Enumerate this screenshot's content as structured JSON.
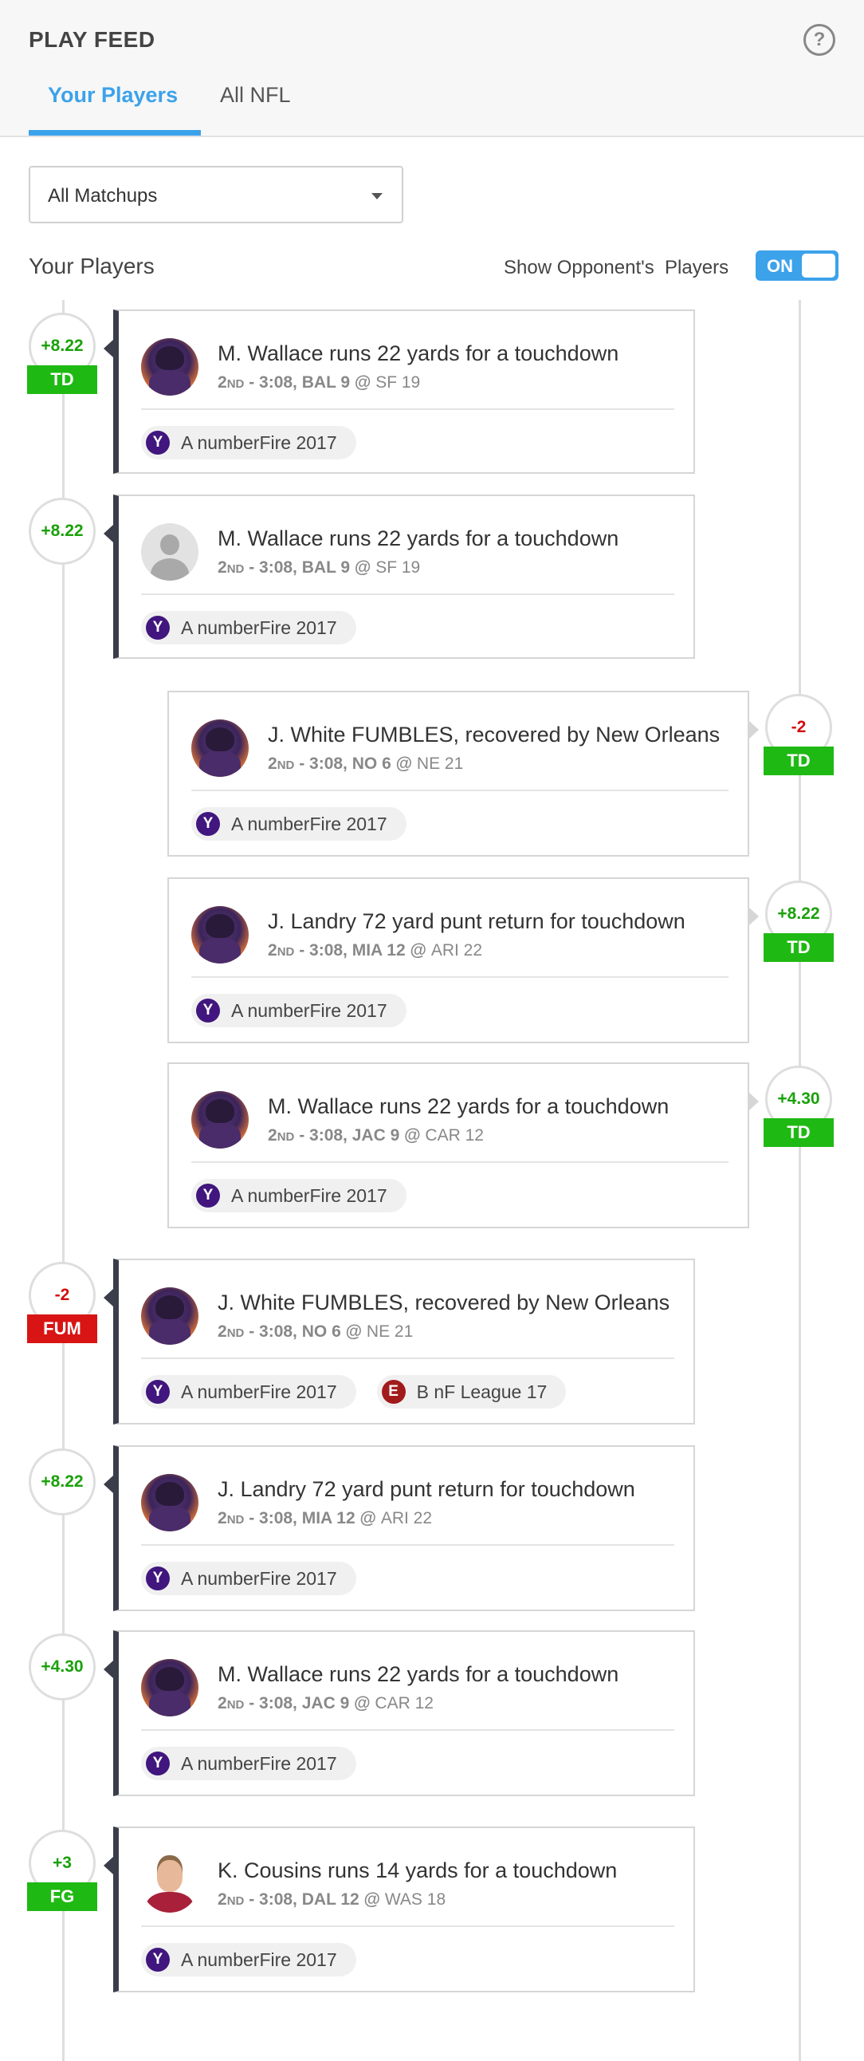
{
  "header": {
    "title": "PLAY FEED",
    "help_icon": "question-circle-icon",
    "tabs": [
      {
        "label": "Your Players",
        "active": true
      },
      {
        "label": "All NFL",
        "active": false
      }
    ]
  },
  "filter": {
    "matchup_select": "All Matchups"
  },
  "section_label": "Your Players",
  "opponent_toggle": {
    "label": "Show Opponent's  Players",
    "state": "ON"
  },
  "colors": {
    "accent": "#3ca2ea",
    "positive": "#1aa10a",
    "negative": "#d40c0c",
    "td_badge": "#1fb913",
    "fum_badge": "#d81414",
    "card_accent": "#3a3d4a"
  },
  "plays": [
    {
      "headline": "M. Wallace runs 22 yards for a touchdown",
      "quarter": "2",
      "quarter_suffix": "ND",
      "clock": " - 3:08, ",
      "team_a": "BAL 9",
      "at": " @ ",
      "team_b": "SF 19",
      "points": "+8.22",
      "tag": "TD",
      "avatar": "ravens-player",
      "leagues": [
        {
          "name": "A numberFire 2017",
          "icon": "Y"
        }
      ]
    },
    {
      "headline": "M. Wallace runs 22 yards for a touchdown",
      "quarter": "2",
      "quarter_suffix": "ND",
      "clock": " - 3:08, ",
      "team_a": "BAL 9",
      "at": " @ ",
      "team_b": "SF 19",
      "points": "+8.22",
      "tag": "",
      "avatar": "generic-user",
      "leagues": [
        {
          "name": "A numberFire 2017",
          "icon": "Y"
        }
      ]
    },
    {
      "headline": "J. White FUMBLES, recovered by New Orleans",
      "quarter": "2",
      "quarter_suffix": "ND",
      "clock": " - 3:08, ",
      "team_a": "NO 6",
      "at": " @ ",
      "team_b": "NE 21",
      "points": "-2",
      "tag": "TD",
      "avatar": "ravens-player",
      "leagues": [
        {
          "name": "A numberFire 2017",
          "icon": "Y"
        }
      ]
    },
    {
      "headline": "J. Landry 72 yard punt return for touchdown",
      "quarter": "2",
      "quarter_suffix": "ND",
      "clock": " - 3:08, ",
      "team_a": "MIA 12",
      "at": " @ ",
      "team_b": "ARI 22",
      "points": "+8.22",
      "tag": "TD",
      "avatar": "ravens-player",
      "leagues": [
        {
          "name": "A numberFire 2017",
          "icon": "Y"
        }
      ]
    },
    {
      "headline": "M. Wallace runs 22 yards for a touchdown",
      "quarter": "2",
      "quarter_suffix": "ND",
      "clock": " - 3:08, ",
      "team_a": "JAC 9",
      "at": " @ ",
      "team_b": "CAR 12",
      "points": "+4.30",
      "tag": "TD",
      "avatar": "ravens-player",
      "leagues": [
        {
          "name": "A numberFire 2017",
          "icon": "Y"
        }
      ]
    },
    {
      "headline": "J. White FUMBLES, recovered by New Orleans",
      "quarter": "2",
      "quarter_suffix": "ND",
      "clock": " - 3:08, ",
      "team_a": "NO 6",
      "at": " @ ",
      "team_b": "NE 21",
      "points": "-2",
      "tag": "FUM",
      "avatar": "ravens-player",
      "leagues": [
        {
          "name": "A numberFire 2017",
          "icon": "Y"
        },
        {
          "name": "B nF League 17",
          "icon": "E"
        }
      ]
    },
    {
      "headline": "J. Landry 72 yard punt return for touchdown",
      "quarter": "2",
      "quarter_suffix": "ND",
      "clock": " - 3:08, ",
      "team_a": "MIA 12",
      "at": " @ ",
      "team_b": "ARI 22",
      "points": "+8.22",
      "tag": "",
      "avatar": "ravens-player",
      "leagues": [
        {
          "name": "A numberFire 2017",
          "icon": "Y"
        }
      ]
    },
    {
      "headline": "M. Wallace runs 22 yards for a touchdown",
      "quarter": "2",
      "quarter_suffix": "ND",
      "clock": " - 3:08, ",
      "team_a": "JAC 9",
      "at": " @ ",
      "team_b": "CAR 12",
      "points": "+4.30",
      "tag": "",
      "avatar": "ravens-player",
      "leagues": [
        {
          "name": "A numberFire 2017",
          "icon": "Y"
        }
      ]
    },
    {
      "headline": "K. Cousins runs 14 yards for a touchdown",
      "quarter": "2",
      "quarter_suffix": "ND",
      "clock": " - 3:08, ",
      "team_a": "DAL 12",
      "at": " @ ",
      "team_b": "WAS 18",
      "points": "+3",
      "tag": "FG",
      "avatar": "cousins-player",
      "leagues": [
        {
          "name": "A numberFire 2017",
          "icon": "Y"
        }
      ]
    }
  ]
}
